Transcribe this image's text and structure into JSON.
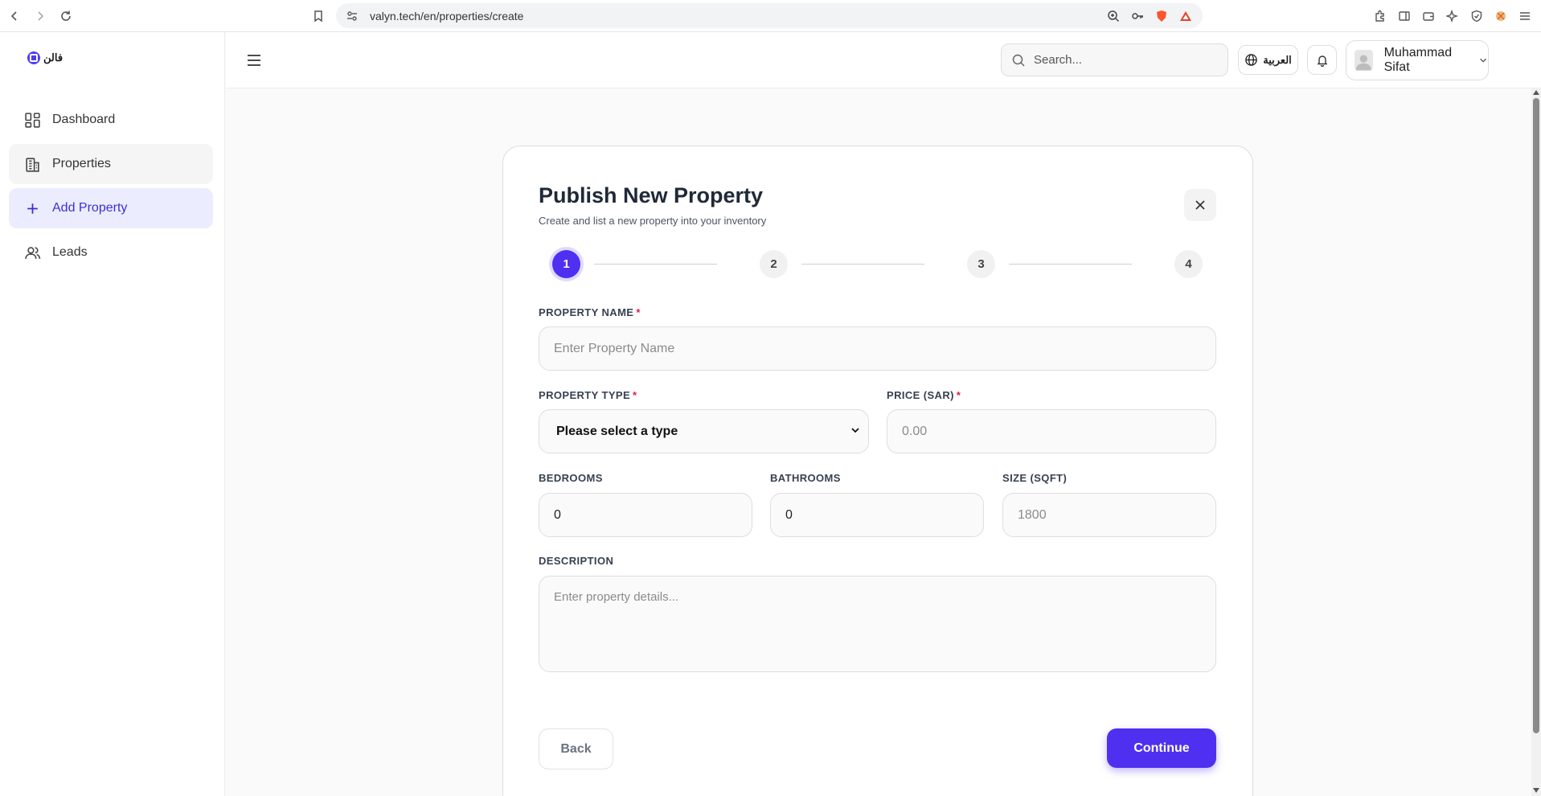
{
  "browser": {
    "url": "valyn.tech/en/properties/create"
  },
  "sidebar": {
    "logo_text": "فالن",
    "items": [
      {
        "label": "Dashboard",
        "icon": "dashboard-icon"
      },
      {
        "label": "Properties",
        "icon": "building-icon"
      },
      {
        "label": "Add Property",
        "icon": "plus-icon"
      },
      {
        "label": "Leads",
        "icon": "users-icon"
      }
    ]
  },
  "header": {
    "search_placeholder": "Search...",
    "language_label": "العربية",
    "user_name": "Muhammad Sifat"
  },
  "form": {
    "title": "Publish New Property",
    "subtitle": "Create and list a new property into your inventory",
    "steps": [
      "1",
      "2",
      "3",
      "4"
    ],
    "active_step": 1,
    "property_name": {
      "label": "PROPERTY NAME",
      "required_mark": "*",
      "placeholder": "Enter Property Name",
      "value": ""
    },
    "property_type": {
      "label": "PROPERTY TYPE",
      "required_mark": "*",
      "selected": "Please select a type"
    },
    "price": {
      "label": "PRICE (SAR)",
      "required_mark": "*",
      "placeholder": "0.00",
      "value": ""
    },
    "bedrooms": {
      "label": "BEDROOMS",
      "value": "0"
    },
    "bathrooms": {
      "label": "BATHROOMS",
      "value": "0"
    },
    "size": {
      "label": "SIZE (SQFT)",
      "placeholder": "1800",
      "value": ""
    },
    "description": {
      "label": "DESCRIPTION",
      "placeholder": "Enter property details...",
      "value": ""
    },
    "back_label": "Back",
    "continue_label": "Continue"
  },
  "colors": {
    "accent": "#4f2ff0",
    "active_nav_bg": "#ebedff",
    "required": "#e11d48"
  }
}
